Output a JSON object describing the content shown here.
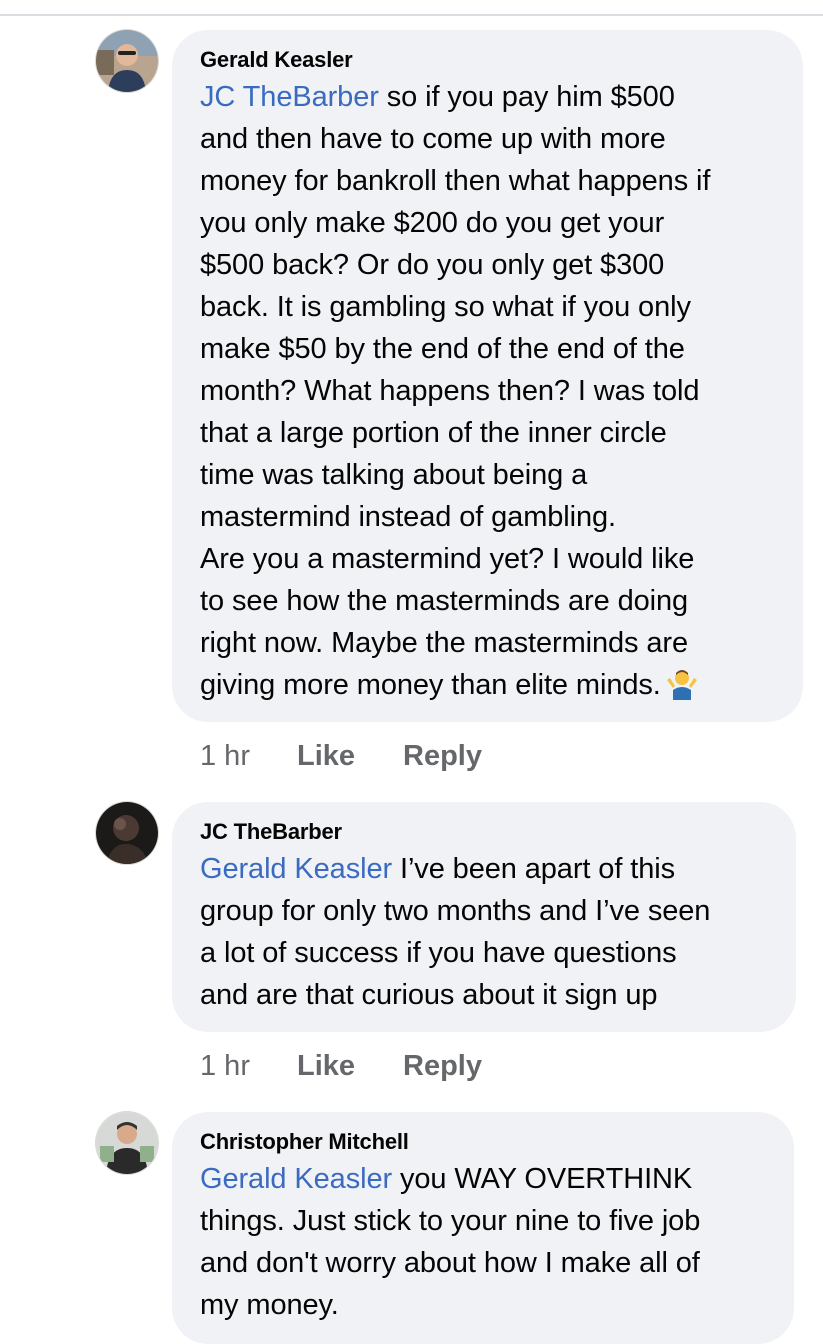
{
  "comments": [
    {
      "author": "Gerald Keasler",
      "mention": "JC TheBarber",
      "lines": [
        " so if you pay him $500",
        "and then have to come up with more",
        "money for bankroll then what happens if",
        "you only make $200 do you get your",
        "$500 back? Or do you only get $300",
        "back. It is gambling so what if you only",
        "make $50 by the end of the end of the",
        "month? What happens then? I was told",
        "that a large portion of the inner circle",
        "time was talking about being a",
        "mastermind instead of gambling.",
        "Are you a mastermind yet? I would like",
        "to see how the masterminds are doing",
        "right now. Maybe the masterminds are",
        "giving more money than elite minds."
      ],
      "emoji": "person-shrugging-emoji",
      "time": "1 hr",
      "like": "Like",
      "reply": "Reply"
    },
    {
      "author": "JC TheBarber",
      "mention": "Gerald Keasler",
      "lines": [
        " I’ve been apart of this",
        "group for only two months and I’ve seen",
        "a lot of success if you have questions",
        "and are that curious about it sign up"
      ],
      "time": "1 hr",
      "like": "Like",
      "reply": "Reply"
    },
    {
      "author": "Christopher Mitchell",
      "mention": "Gerald Keasler",
      "lines": [
        " you WAY OVERTHINK",
        "things. Just stick to your nine to five job",
        "and don't worry about how I make all of",
        "my money."
      ]
    }
  ],
  "colors": {
    "mention": "#3b6bc0",
    "bubble": "#f0f2f5",
    "meta": "#65676b"
  }
}
